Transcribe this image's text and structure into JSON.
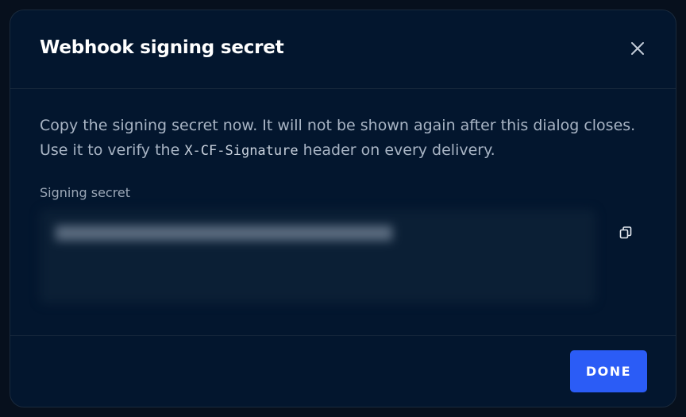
{
  "dialog": {
    "title": "Webhook signing secret",
    "description_before": "Copy the signing secret now. It will not be shown again after this dialog closes. Use it to verify the ",
    "description_code": "X-CF-Signature",
    "description_after": " header on every delivery.",
    "field_label": "Signing secret",
    "done_label": "DONE",
    "icons": {
      "close": "close-icon",
      "copy": "copy-icon"
    },
    "colors": {
      "accent": "#2b5cf6",
      "background": "#03162e"
    }
  }
}
